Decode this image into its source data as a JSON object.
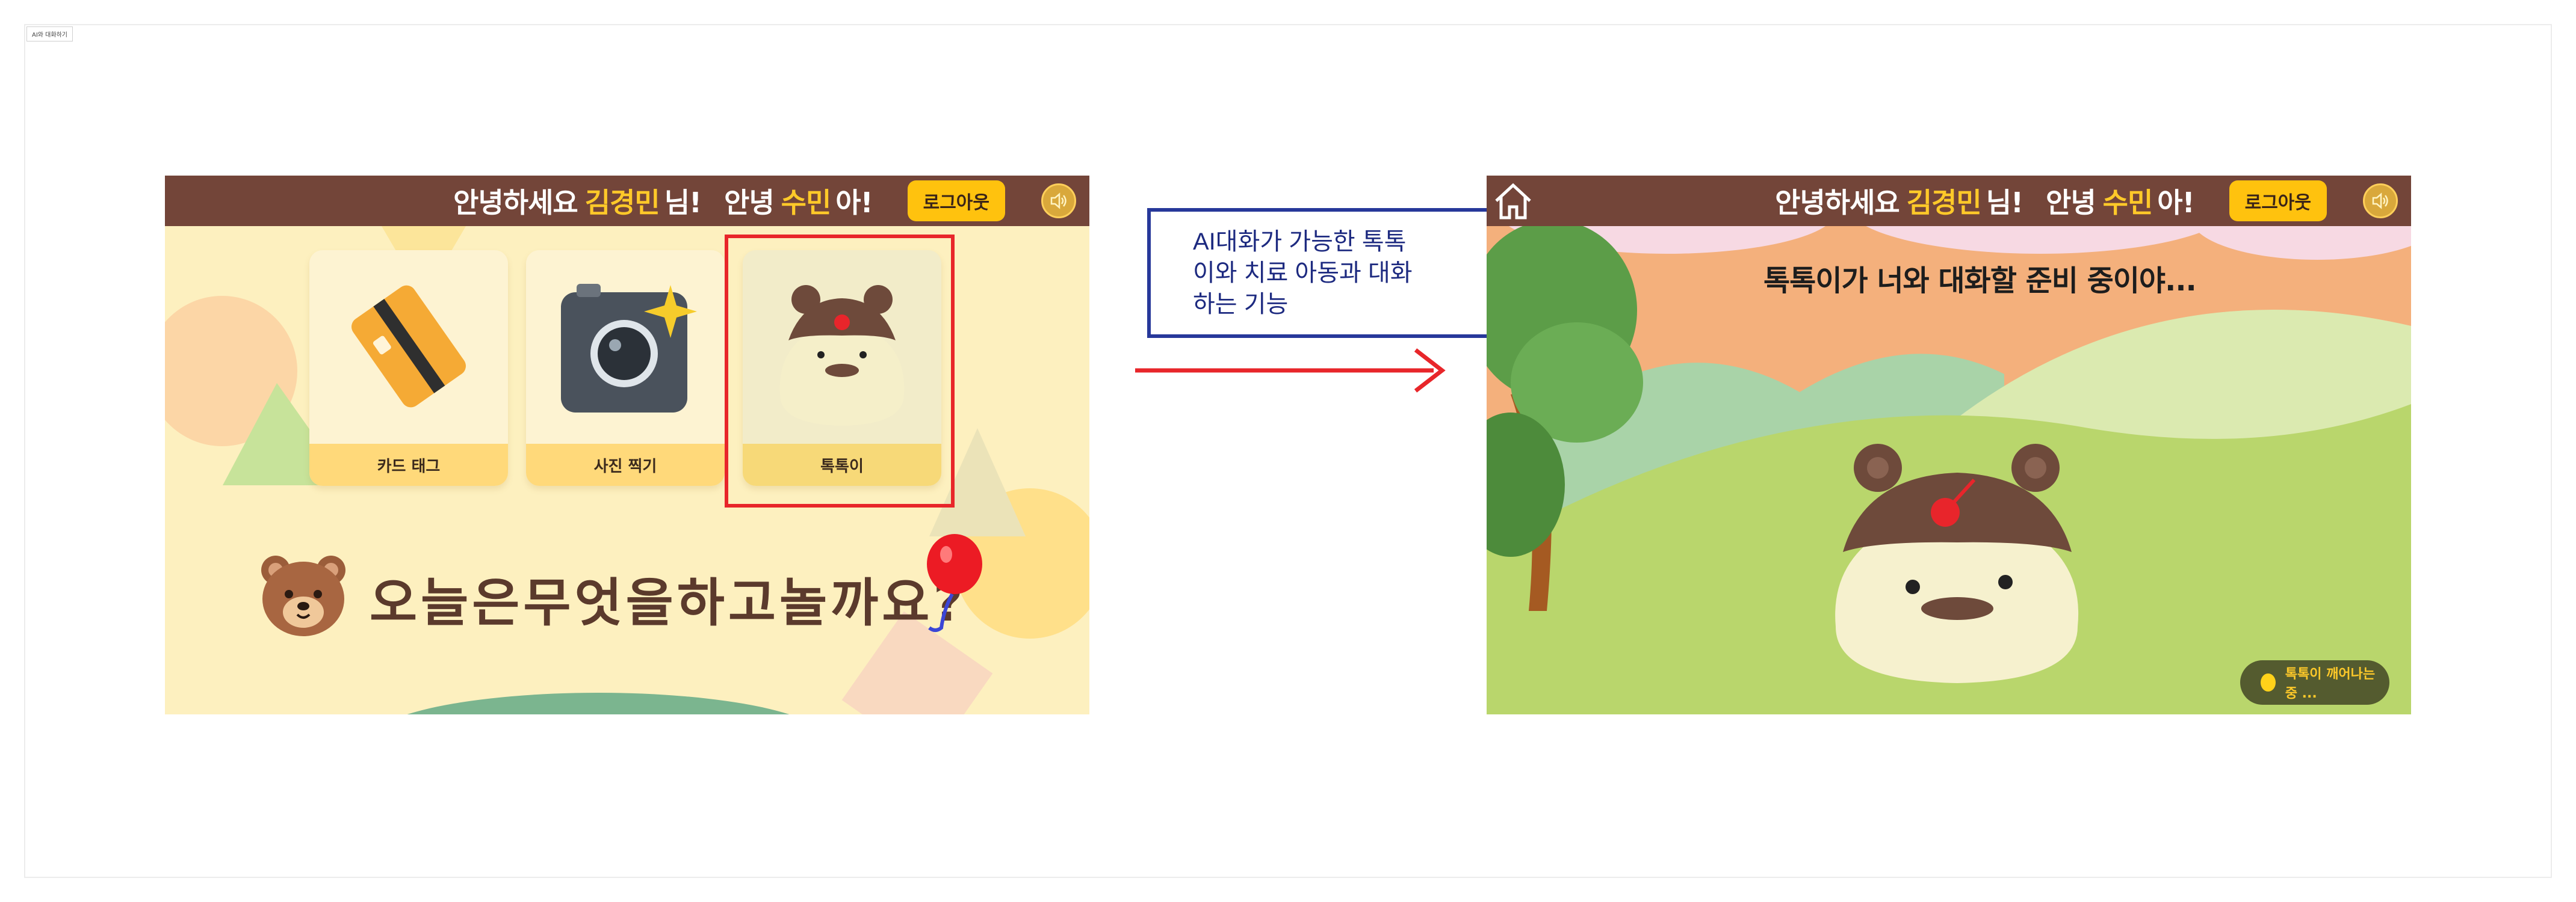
{
  "board": {
    "label": "AI와 대화하기"
  },
  "header": {
    "hello": "안녕하세요",
    "parent_name": "김경민",
    "parent_suffix": "님!",
    "child_hello": "안녕",
    "child_name": "수민",
    "child_suffix": "아!",
    "logout_label": "로그아웃"
  },
  "menu": {
    "cards": [
      {
        "label": "카드 태그",
        "icon": "card-icon"
      },
      {
        "label": "사진 찍기",
        "icon": "camera-icon"
      },
      {
        "label": "톡톡이",
        "icon": "tokto-character-icon"
      }
    ],
    "question": "오늘은무엇을하고놀까요?"
  },
  "chat": {
    "ready_text": "톡톡이가 너와 대화할 준비 중이야...",
    "loading_text": "톡톡이 깨어나는 중 ..."
  },
  "annotation": {
    "lines": [
      "AI대화가 가능한 톡톡",
      "이와 치료 아동과 대화",
      "하는 기능"
    ]
  },
  "colors": {
    "topbar": "#734539",
    "highlight": "#ffc929",
    "logout_button": "#ffc20e",
    "selection_border": "#e8262a",
    "annotation_border": "#27389a",
    "arrow": "#e8262a"
  }
}
